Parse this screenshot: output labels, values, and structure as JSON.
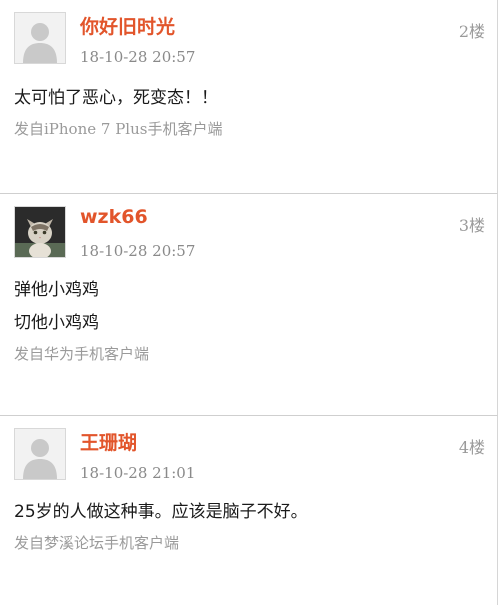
{
  "posts": [
    {
      "username": "你好旧时光",
      "time": "18-10-28 20:57",
      "floor": "2楼",
      "avatar_icon": "default-user-avatar",
      "content": [
        "太可怕了恶心，死变态！！"
      ],
      "source": "发自iPhone 7 Plus手机客户端"
    },
    {
      "username": "wzk66",
      "time": "18-10-28 20:57",
      "floor": "3楼",
      "avatar_icon": "cat-photo-avatar",
      "content": [
        "弹他小鸡鸡",
        "切他小鸡鸡"
      ],
      "source": "发自华为手机客户端"
    },
    {
      "username": "王珊瑚",
      "time": "18-10-28 21:01",
      "floor": "4楼",
      "avatar_icon": "default-user-avatar",
      "content": [
        "25岁的人做这种事。应该是脑子不好。"
      ],
      "source": "发自梦溪论坛手机客户端"
    }
  ],
  "colors": {
    "username": "#e2552b",
    "meta": "#9a9a9a",
    "text": "#1a1a1a",
    "divider": "#cfcfcf"
  }
}
